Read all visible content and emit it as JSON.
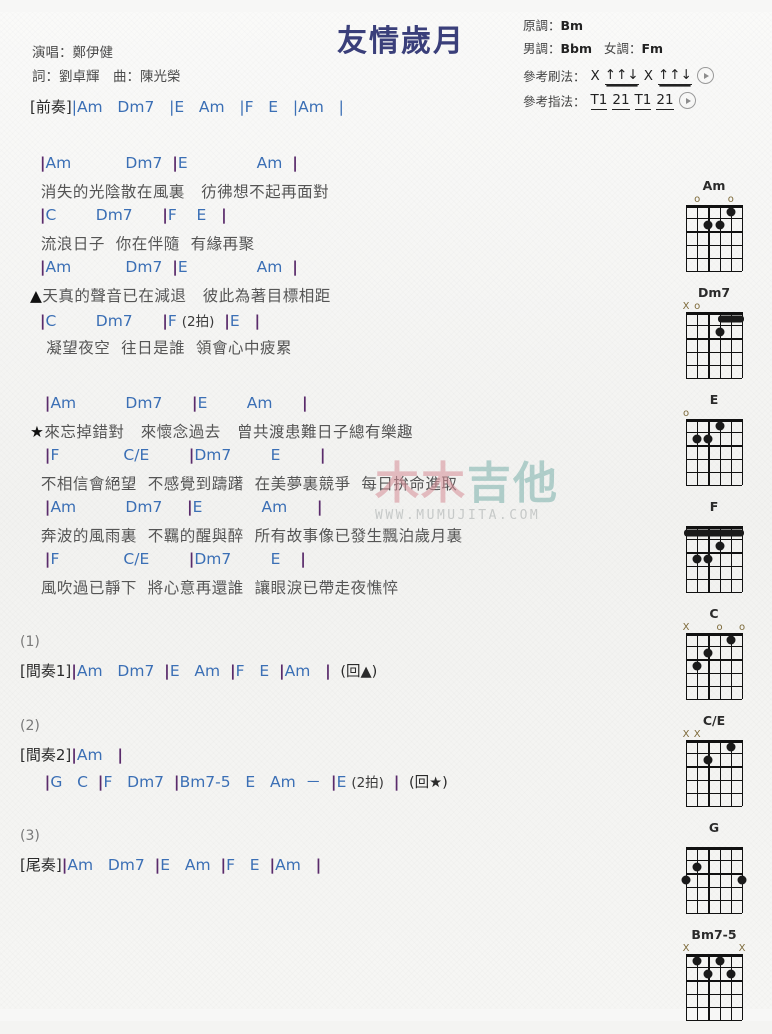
{
  "song": {
    "title": "友情歲月",
    "singer_label": "演唱：鄭伊健",
    "writer_label": "詞：劉卓輝　曲：陳光榮"
  },
  "keyinfo": {
    "original_label": "原調：",
    "original_key": "Bm",
    "male_label": "男調：",
    "male_key": "Bbm",
    "female_label": "女調：",
    "female_key": "Fm",
    "strum_label": "參考刷法：",
    "strum_x1": "X",
    "strum_p1": "↑↑↓",
    "strum_x2": "X",
    "strum_p2": "↑↑↓",
    "pick_label": "參考指法：",
    "pick_1": "T1",
    "pick_2": "21",
    "pick_3": "T1",
    "pick_4": "21"
  },
  "intro": {
    "section": "[前奏]",
    "chords": "|Am   Dm7   |E   Am   |F   E   |Am   |"
  },
  "verse1": [
    {
      "type": "chord",
      "text": "  |Am           Dm7  |E              Am  |"
    },
    {
      "type": "lyric",
      "text": "  消失的光陰散在風裏   彷彿想不起再面對"
    },
    {
      "type": "chord",
      "text": "  |C        Dm7      |F    E   |"
    },
    {
      "type": "lyric",
      "text": "  流浪日子  你在伴隨  有緣再聚"
    },
    {
      "type": "chord",
      "text": "  |Am           Dm7  |E              Am  |"
    },
    {
      "type": "lyric",
      "text": "▲天真的聲音已在減退   彼此為著目標相距"
    },
    {
      "type": "chord",
      "text": "  |C        Dm7      |F (2拍)  |E   |"
    },
    {
      "type": "lyric",
      "text": "   凝望夜空  往日是誰  領會心中疲累"
    }
  ],
  "chorus": [
    {
      "type": "chord",
      "text": "   |Am          Dm7      |E        Am      |"
    },
    {
      "type": "lyric",
      "text": "★來忘掉錯對   來懷念過去   曾共渡患難日子總有樂趣"
    },
    {
      "type": "chord",
      "text": "   |F             C/E        |Dm7        E        |"
    },
    {
      "type": "lyric",
      "text": "  不相信會絕望  不感覺到躊躇  在美夢裏競爭  每日拚命進取"
    },
    {
      "type": "chord",
      "text": "   |Am          Dm7     |E            Am      |"
    },
    {
      "type": "lyric",
      "text": "  奔波的風雨裏  不羈的醒與醉  所有故事像已發生飄泊歲月裏"
    },
    {
      "type": "chord",
      "text": "   |F             C/E        |Dm7        E    |"
    },
    {
      "type": "lyric",
      "text": "  風吹過已靜下  將心意再還誰  讓眼淚已帶走夜憔悴"
    }
  ],
  "endings": [
    {
      "num": "(1)",
      "section": "[間奏1]",
      "chords": "|Am   Dm7  |E   Am  |F   E  |Am   |",
      "repeat": "(回▲)"
    },
    {
      "num": "(2)",
      "section": "[間奏2]",
      "chords": "|Am   |",
      "chords2": "     |G   C  |F   Dm7  |Bm7-5   E   Am  －  |E (2拍)  |",
      "repeat": "(回★)"
    },
    {
      "num": "(3)",
      "section": "[尾奏]",
      "chords": "|Am   Dm7  |E   Am  |F   E  |Am   |",
      "repeat": ""
    }
  ],
  "chord_diagrams": [
    {
      "name": "Am",
      "markers": [
        {
          "s": 5,
          "m": "o"
        },
        {
          "s": 2,
          "m": "o"
        }
      ],
      "dots": [
        {
          "s": 2,
          "f": 1
        },
        {
          "s": 4,
          "f": 2
        },
        {
          "s": 3,
          "f": 2
        }
      ],
      "barres": []
    },
    {
      "name": "Dm7",
      "markers": [
        {
          "s": 6,
          "m": "X"
        },
        {
          "s": 5,
          "m": "o"
        }
      ],
      "dots": [
        {
          "s": 3,
          "f": 2
        }
      ],
      "barres": [
        {
          "f": 1,
          "from": 3,
          "to": 1
        }
      ]
    },
    {
      "name": "E",
      "markers": [
        {
          "s": 6,
          "m": "o"
        }
      ],
      "dots": [
        {
          "s": 3,
          "f": 1
        },
        {
          "s": 5,
          "f": 2
        },
        {
          "s": 4,
          "f": 2
        }
      ],
      "barres": []
    },
    {
      "name": "F",
      "markers": [],
      "dots": [
        {
          "s": 3,
          "f": 2
        },
        {
          "s": 5,
          "f": 3
        },
        {
          "s": 4,
          "f": 3
        }
      ],
      "barres": [
        {
          "f": 1,
          "from": 6,
          "to": 1
        }
      ]
    },
    {
      "name": "C",
      "markers": [
        {
          "s": 6,
          "m": "X"
        },
        {
          "s": 3,
          "m": "o"
        },
        {
          "s": 1,
          "m": "o"
        }
      ],
      "dots": [
        {
          "s": 2,
          "f": 1
        },
        {
          "s": 4,
          "f": 2
        },
        {
          "s": 5,
          "f": 3
        }
      ],
      "barres": []
    },
    {
      "name": "C/E",
      "markers": [
        {
          "s": 6,
          "m": "X"
        },
        {
          "s": 5,
          "m": "X"
        }
      ],
      "dots": [
        {
          "s": 2,
          "f": 1
        },
        {
          "s": 4,
          "f": 2
        }
      ],
      "barres": []
    },
    {
      "name": "G",
      "markers": [],
      "dots": [
        {
          "s": 5,
          "f": 2
        },
        {
          "s": 6,
          "f": 3
        },
        {
          "s": 1,
          "f": 3
        }
      ],
      "barres": []
    },
    {
      "name": "Bm7-5",
      "markers": [
        {
          "s": 6,
          "m": "X"
        },
        {
          "s": 1,
          "m": "X"
        }
      ],
      "dots": [
        {
          "s": 5,
          "f": 1
        },
        {
          "s": 3,
          "f": 1
        },
        {
          "s": 4,
          "f": 2
        },
        {
          "s": 2,
          "f": 2
        }
      ],
      "barres": []
    }
  ],
  "watermark": {
    "text_a": "木木",
    "text_b": "吉他",
    "url": "WWW.MUMUJITA.COM"
  },
  "colors": {
    "title": "#3a3f7a",
    "chord": "#3b6fb5",
    "bar": "#5a2b6b",
    "lyric": "#555555"
  }
}
